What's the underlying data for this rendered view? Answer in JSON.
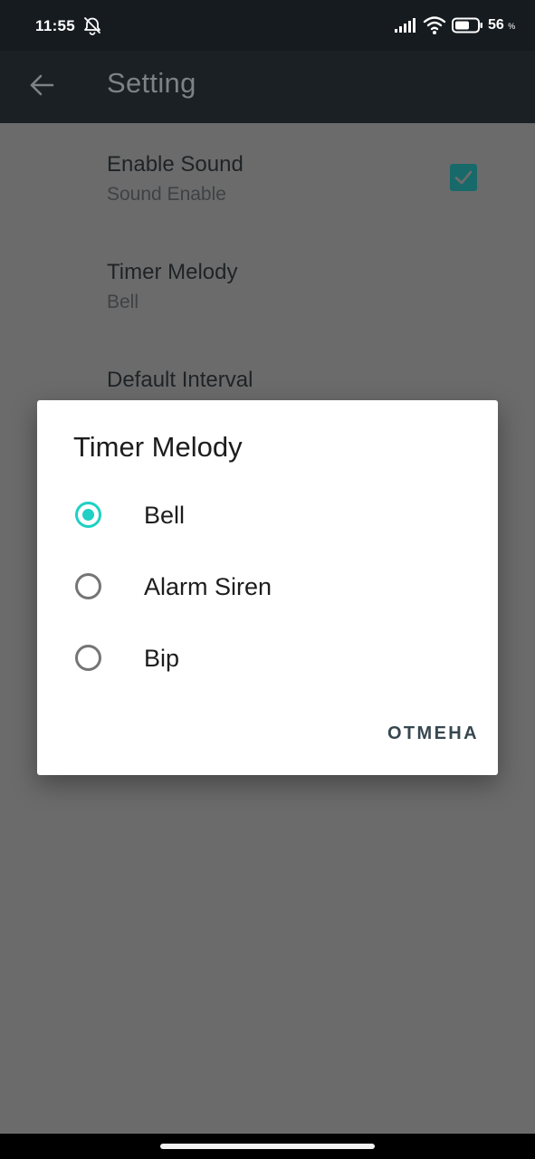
{
  "status_bar": {
    "time": "11:55",
    "battery_percent": "56",
    "battery_unit": "%",
    "icons": [
      "alarm-off-icon",
      "signal-icon",
      "wifi-icon",
      "battery-icon"
    ]
  },
  "app_bar": {
    "title": "Setting",
    "back_icon": "arrow-back-icon"
  },
  "settings": [
    {
      "title": "Enable Sound",
      "summary": "Sound Enable",
      "checked": true
    },
    {
      "title": "Timer Melody",
      "summary": "Bell"
    },
    {
      "title": "Default Interval"
    }
  ],
  "dialog": {
    "title": "Timer Melody",
    "options": [
      {
        "label": "Bell",
        "selected": true
      },
      {
        "label": "Alarm Siren",
        "selected": false
      },
      {
        "label": "Bip",
        "selected": false
      }
    ],
    "cancel_label": "ОТМЕНА"
  },
  "colors": {
    "accent": "#1fd0c4",
    "checkbox": "#17696a",
    "app_bar": "#1a2024",
    "scrim_background": "#6b6b6b",
    "button_text": "#36474f"
  }
}
